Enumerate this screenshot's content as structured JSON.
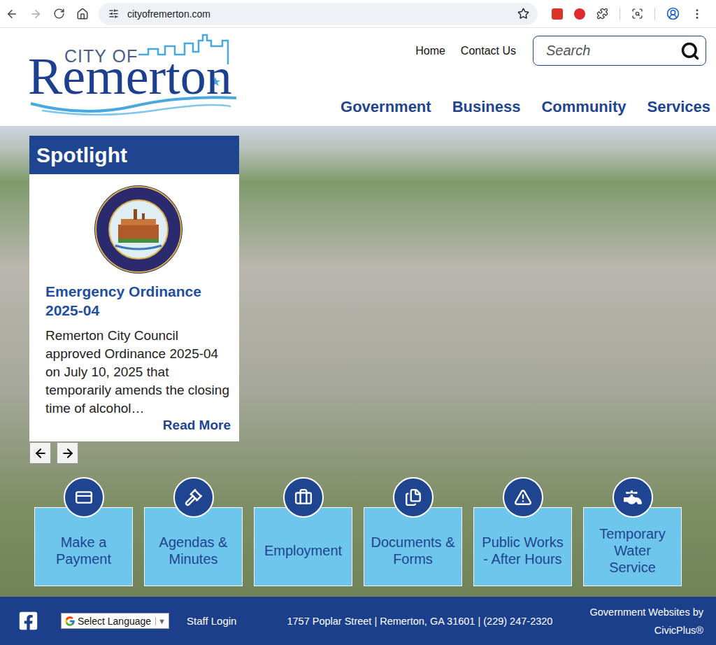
{
  "browser": {
    "url": "cityofremerton.com"
  },
  "logo": {
    "small": "CITY OF",
    "name": "Remerton"
  },
  "utility_links": [
    "Home",
    "Contact Us"
  ],
  "search": {
    "placeholder": "Search"
  },
  "nav": [
    "Government",
    "Business",
    "Community",
    "Services"
  ],
  "spotlight": {
    "title": "Spotlight",
    "heading": "Emergency Ordinance 2025-04",
    "body": "Remerton City Council approved Ordinance 2025-04 on July 10, 2025 that temporarily amends the closing time of alcohol…",
    "link": "Read More"
  },
  "quick_links": [
    "Make a Payment",
    "Agendas & Minutes",
    "Employment",
    "Documents & Forms",
    "Public Works - After Hours",
    "Temporary Water Service"
  ],
  "footer": {
    "language": "Select Language",
    "language_arrow": "▼",
    "staff_login": "Staff Login",
    "address": "1757 Poplar Street | Remerton, GA 31601 | (229) 247-2320",
    "credit": "Government Websites by CivicPlus®"
  }
}
